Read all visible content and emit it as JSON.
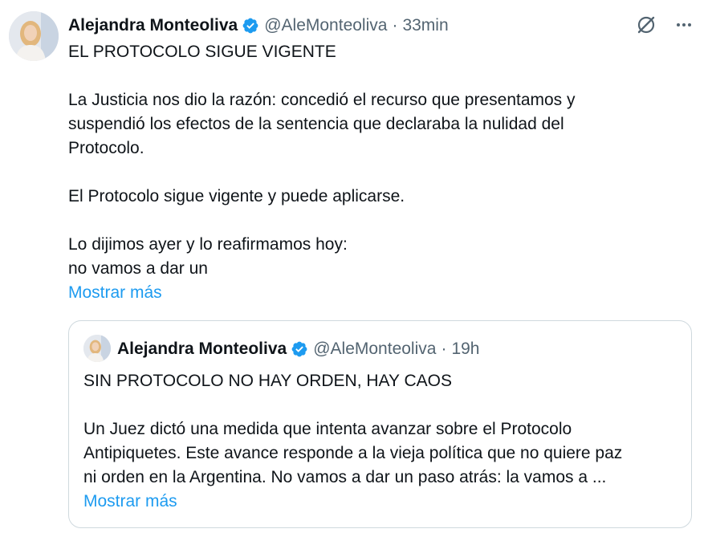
{
  "tweet": {
    "author_name": "Alejandra Monteoliva",
    "handle": "@AleMonteoliva",
    "separator": "·",
    "time": "33min",
    "lines": [
      "EL PROTOCOLO SIGUE VIGENTE",
      "La Justicia nos dio la razón: concedió el recurso que presentamos y",
      "suspendió los efectos de la sentencia que declaraba la nulidad del",
      "Protocolo.",
      "El Protocolo sigue vigente y puede aplicarse.",
      "Lo dijimos ayer y lo reafirmamos hoy:",
      "no vamos a dar un"
    ],
    "show_more": "Mostrar más"
  },
  "quote": {
    "author_name": "Alejandra Monteoliva",
    "handle": "@AleMonteoliva",
    "separator": "·",
    "time": "19h",
    "lines": [
      "SIN PROTOCOLO NO HAY ORDEN, HAY CAOS",
      "Un Juez dictó una medida que intenta avanzar sobre el Protocolo",
      "Antipiquetes. Este avance responde a la vieja política que no quiere paz",
      "ni orden en la Argentina. No vamos a dar un paso atrás: la vamos a ..."
    ],
    "show_more": "Mostrar más"
  },
  "icons": {
    "verified": "verified-badge-icon",
    "grok": "grok-icon",
    "more": "more-options-icon"
  },
  "colors": {
    "text": "#0f1419",
    "secondary": "#536471",
    "link": "#1d9bf0",
    "border": "#cfd9de"
  }
}
